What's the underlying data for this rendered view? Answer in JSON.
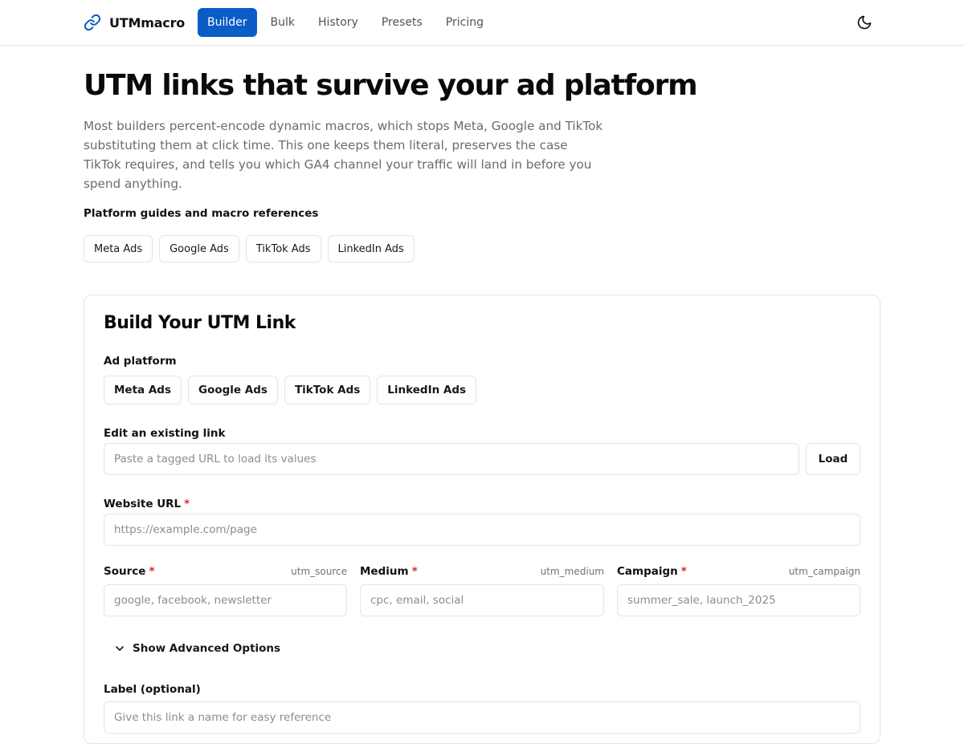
{
  "nav": {
    "brand": "UTMmacro",
    "items": [
      {
        "label": "Builder",
        "active": true
      },
      {
        "label": "Bulk",
        "active": false
      },
      {
        "label": "History",
        "active": false
      },
      {
        "label": "Presets",
        "active": false
      },
      {
        "label": "Pricing",
        "active": false
      }
    ],
    "theme_icon": "moon-icon"
  },
  "hero": {
    "title": "UTM links that survive your ad platform",
    "description": "Most builders percent-encode dynamic macros, which stops Meta, Google and TikTok substituting them at click time. This one keeps them literal, preserves the case TikTok requires, and tells you which GA4 channel your traffic will land in before you spend anything.",
    "guides_label": "Platform guides and macro references",
    "guides": [
      "Meta Ads",
      "Google Ads",
      "TikTok Ads",
      "LinkedIn Ads"
    ]
  },
  "builder": {
    "title": "Build Your UTM Link",
    "platform_label": "Ad platform",
    "platforms": [
      "Meta Ads",
      "Google Ads",
      "TikTok Ads",
      "LinkedIn Ads"
    ],
    "edit_label": "Edit an existing link",
    "edit_placeholder": "Paste a tagged URL to load its values",
    "load_button": "Load",
    "website_label": "Website URL",
    "website_placeholder": "https://example.com/page",
    "source_label": "Source",
    "source_param": "utm_source",
    "source_placeholder": "google, facebook, newsletter",
    "medium_label": "Medium",
    "medium_param": "utm_medium",
    "medium_placeholder": "cpc, email, social",
    "campaign_label": "Campaign",
    "campaign_param": "utm_campaign",
    "campaign_placeholder": "summer_sale, launch_2025",
    "required_mark": "*",
    "advanced_toggle": "Show Advanced Options",
    "label_label": "Label (optional)",
    "label_placeholder": "Give this link a name for easy reference"
  },
  "colors": {
    "accent": "#0a5cc7",
    "required": "#dc2626",
    "border": "#e4e4e7"
  }
}
